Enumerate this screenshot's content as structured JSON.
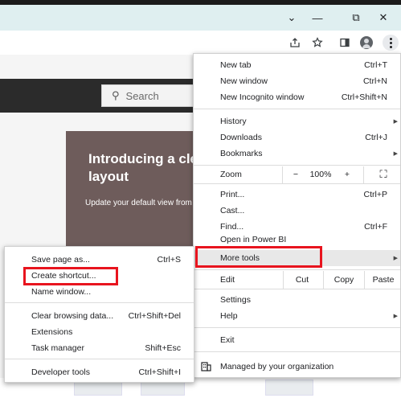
{
  "browser": {
    "window_controls": [
      "⌄",
      "—",
      "⧉",
      "✕"
    ],
    "search_placeholder": "Search"
  },
  "promo": {
    "title": "Introducing a clean layout",
    "subtitle": "Update your default view from"
  },
  "main_menu": {
    "new_tab": {
      "label": "New tab",
      "shortcut": "Ctrl+T"
    },
    "new_window": {
      "label": "New window",
      "shortcut": "Ctrl+N"
    },
    "new_incognito": {
      "label": "New Incognito window",
      "shortcut": "Ctrl+Shift+N"
    },
    "history": {
      "label": "History"
    },
    "downloads": {
      "label": "Downloads",
      "shortcut": "Ctrl+J"
    },
    "bookmarks": {
      "label": "Bookmarks"
    },
    "zoom": {
      "label": "Zoom",
      "minus": "−",
      "level": "100%",
      "plus": "+",
      "fullscreen": "⛶"
    },
    "print": {
      "label": "Print...",
      "shortcut": "Ctrl+P"
    },
    "cast": {
      "label": "Cast..."
    },
    "find": {
      "label": "Find...",
      "shortcut": "Ctrl+F"
    },
    "open_in_powerbi": {
      "label": "Open in Power BI"
    },
    "more_tools": {
      "label": "More tools"
    },
    "edit": {
      "label": "Edit",
      "cut": "Cut",
      "copy": "Copy",
      "paste": "Paste"
    },
    "settings": {
      "label": "Settings"
    },
    "help": {
      "label": "Help"
    },
    "exit": {
      "label": "Exit"
    },
    "managed": {
      "label": "Managed by your organization"
    }
  },
  "sub_menu": {
    "save_page": {
      "label": "Save page as...",
      "shortcut": "Ctrl+S"
    },
    "create_shortcut": {
      "label": "Create shortcut..."
    },
    "name_window": {
      "label": "Name window..."
    },
    "clear_browsing": {
      "label": "Clear browsing data...",
      "shortcut": "Ctrl+Shift+Del"
    },
    "extensions": {
      "label": "Extensions"
    },
    "task_manager": {
      "label": "Task manager",
      "shortcut": "Shift+Esc"
    },
    "developer_tools": {
      "label": "Developer tools",
      "shortcut": "Ctrl+Shift+I"
    }
  },
  "colors": {
    "titlebar": "#dfeff0",
    "highlight_box": "#e8141e",
    "promo_bg": "#6e5c5b"
  }
}
